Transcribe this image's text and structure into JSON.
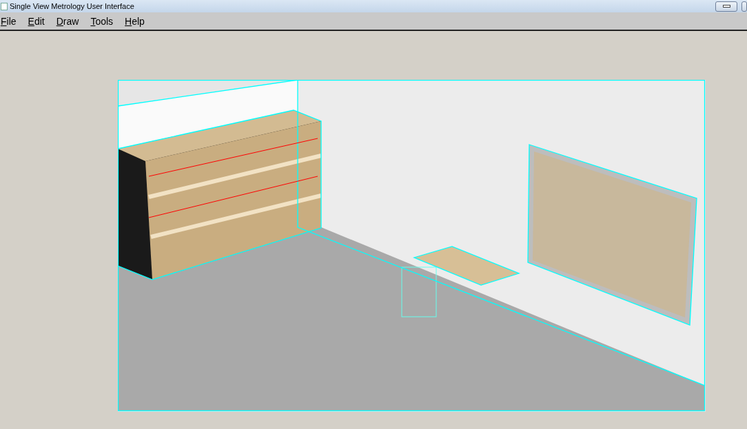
{
  "window": {
    "title": "Single View Metrology User Interface"
  },
  "menu": [
    {
      "label": "File"
    },
    {
      "label": "Edit"
    },
    {
      "label": "Draw"
    },
    {
      "label": "Tools"
    },
    {
      "label": "Help"
    }
  ]
}
